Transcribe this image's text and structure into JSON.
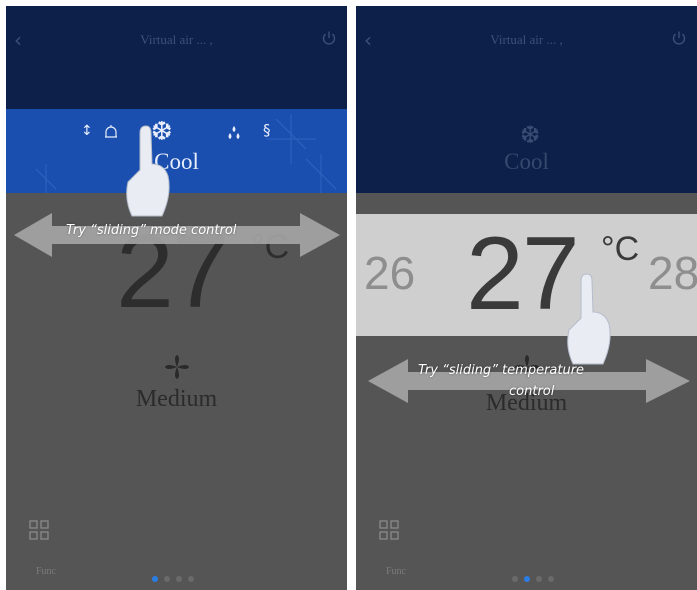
{
  "colors": {
    "topbar": "#0c2049",
    "mode_band_active": "#1a4fb0",
    "body_gray": "#555556",
    "temp_band": "#cfcfcf",
    "page_indicator_active": "#2b7de6"
  },
  "screens": [
    {
      "header": {
        "title": "Virtual air ... ,",
        "back_icon": "chevron-left-icon",
        "power_icon": "power-icon"
      },
      "mode": {
        "label": "Cool",
        "icons": [
          "swing-icon",
          "bell-icon",
          "snowflake-icon",
          "dry-icon",
          "wind-icon"
        ],
        "selected": "snowflake-icon"
      },
      "temperature": {
        "value": "27",
        "unit": "°C"
      },
      "fan": {
        "label": "Medium",
        "icon": "fan-icon"
      },
      "func": {
        "label": "Func",
        "icon": "grid-icon"
      },
      "page_indicator": {
        "count": 4,
        "active_index": 0
      },
      "hint": {
        "text": "Try “sliding” mode control"
      }
    },
    {
      "header": {
        "title": "Virtual air ... ,",
        "back_icon": "chevron-left-icon",
        "power_icon": "power-icon"
      },
      "mode": {
        "label": "Cool",
        "icon": "snowflake-icon"
      },
      "temperature": {
        "previous": "26",
        "value": "27",
        "next": "28",
        "unit": "°C"
      },
      "fan": {
        "label": "Medium",
        "icon": "fan-icon"
      },
      "func": {
        "label": "Func",
        "icon": "grid-icon"
      },
      "page_indicator": {
        "count": 4,
        "active_index": 1
      },
      "hint": {
        "line1": "Try “sliding” temperature",
        "line2": "control"
      }
    }
  ]
}
